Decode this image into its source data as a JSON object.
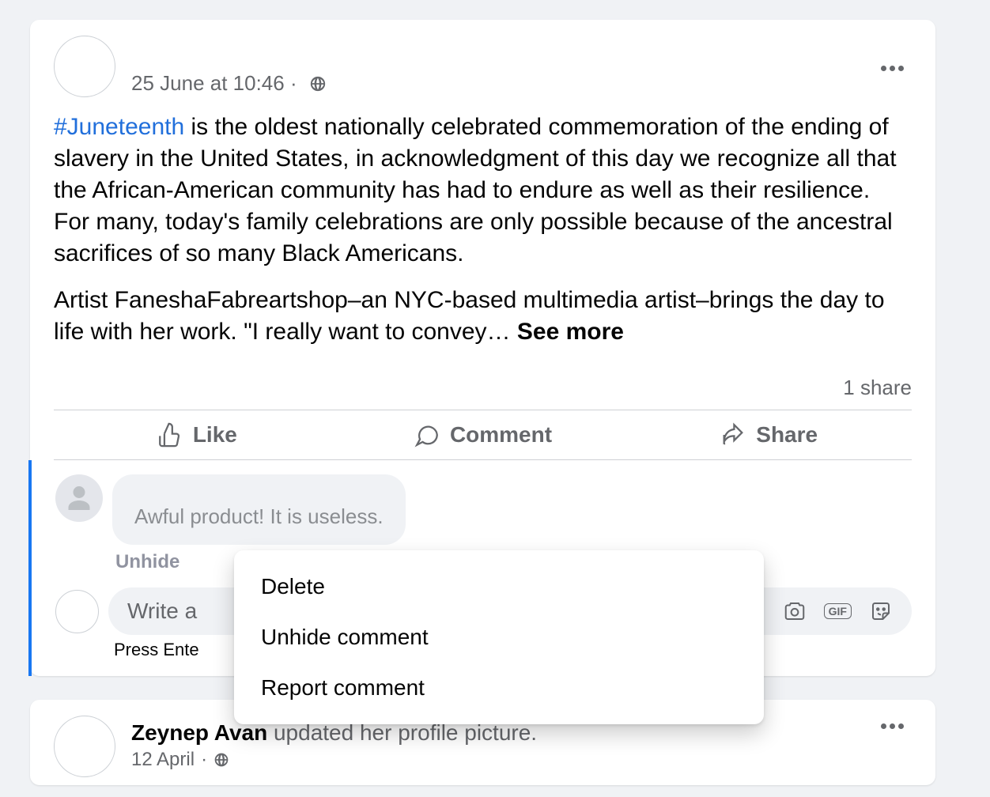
{
  "post": {
    "timestamp": "25 June at 10:46",
    "privacy": "public",
    "hashtag": "#Juneteenth",
    "body_para1_after_hashtag": " is the oldest nationally celebrated commemoration of the ending of slavery in the United States, in acknowledgment of this day we recognize all that the African-American community has had to endure as well as their resilience. For many, today's family celebrations are only possible because of the ancestral sacrifices of so many Black Americans.",
    "body_para2": "Artist FaneshaFabreartshop–an NYC-based multimedia artist–brings the day to life with her work. \"I really want to convey… ",
    "see_more": "See more",
    "share_count": "1 share",
    "actions": {
      "like": "Like",
      "comment": "Comment",
      "share": "Share"
    }
  },
  "comment": {
    "text": "Awful product! It is useless.",
    "unhide": "Unhide"
  },
  "composer": {
    "placeholder": "Write a",
    "hint": "Press Ente"
  },
  "context_menu": {
    "delete": "Delete",
    "unhide": "Unhide comment",
    "report": "Report comment"
  },
  "second_post": {
    "name": "Zeynep Avan",
    "suffix": " updated her profile picture.",
    "date": "12 April"
  }
}
